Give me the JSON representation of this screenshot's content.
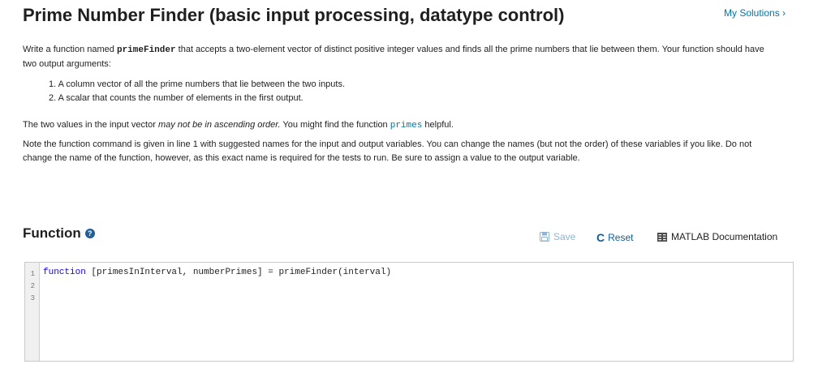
{
  "header": {
    "title": "Prime Number Finder (basic input processing, datatype control)",
    "my_solutions": "My Solutions ›"
  },
  "description": {
    "p1_pre": "Write a function named ",
    "p1_fn": "primeFinder",
    "p1_post": " that accepts a two-element vector of distinct positive integer values and finds all the prime numbers that lie between them. Your function should have two output arguments:",
    "items": [
      "1. A column vector of all the prime numbers that lie between the two inputs.",
      "2. A scalar that counts the number of elements in the first output."
    ],
    "p2_pre": "The two values in the input vector ",
    "p2_em": "may not be in ascending order.",
    "p2_mid": " You might find the function ",
    "p2_code": "primes",
    "p2_post": " helpful.",
    "p3": "Note the function command is given in line 1 with suggested names for the input and output variables.  You can change the names (but not the order) of these variables if you like.  Do not change the name of the function, however, as this exact name is required for the tests to run.  Be sure to assign a value to the output variable."
  },
  "function_section": {
    "heading": "Function",
    "help_icon": "question-circle-icon",
    "toolbar": {
      "save_label": "Save",
      "reset_label": "Reset",
      "doc_label": "MATLAB Documentation"
    }
  },
  "editor": {
    "line_numbers": [
      "1",
      "2",
      "3"
    ],
    "line1_keyword": "function",
    "line1_rest": " [primesInInterval, numberPrimes] = primeFinder(interval)"
  }
}
